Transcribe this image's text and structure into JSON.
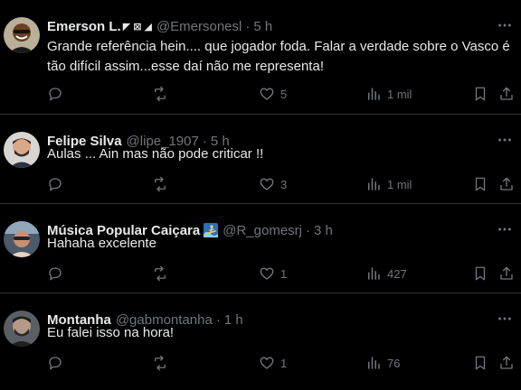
{
  "tweets": [
    {
      "name": "Emerson L.",
      "badges": "◤ ⊠ ◢",
      "handle": "@Emersonesl",
      "dot": "·",
      "time": "5 h",
      "text": "Grande referência hein.... que jogador foda. Falar a verdade sobre o Vasco é tão difícil assim...esse daí não me representa!",
      "likes": "5",
      "views": "1 mil"
    },
    {
      "name": "Felipe Silva",
      "handle": "@lipe_1907",
      "dot": "·",
      "time": "5 h",
      "text": "Aulas ... Ain mas não pode criticar !!",
      "likes": "3",
      "views": "1 mil"
    },
    {
      "name": "Música Popular Caiçara",
      "badge_icon": "surfer-emoji-icon",
      "handle": "@R_gomesrj",
      "dot": "·",
      "time": "3 h",
      "text": "Hahaha excelente",
      "likes": "1",
      "views": "427"
    },
    {
      "name": "Montanha",
      "handle": "@gabmontanha",
      "dot": "·",
      "time": "1 h",
      "text": "Eu falei isso na hora!",
      "likes": "1",
      "views": "76"
    }
  ],
  "icons": {
    "more": "more-horizontal-icon",
    "reply": "reply-icon",
    "retweet": "retweet-icon",
    "like": "heart-icon",
    "views": "views-chart-icon",
    "bookmark": "bookmark-icon",
    "share": "share-icon"
  },
  "colors": {
    "background": "#000000",
    "text": "#e7e9ea",
    "secondary": "#71767b",
    "divider": "#2f3336"
  }
}
